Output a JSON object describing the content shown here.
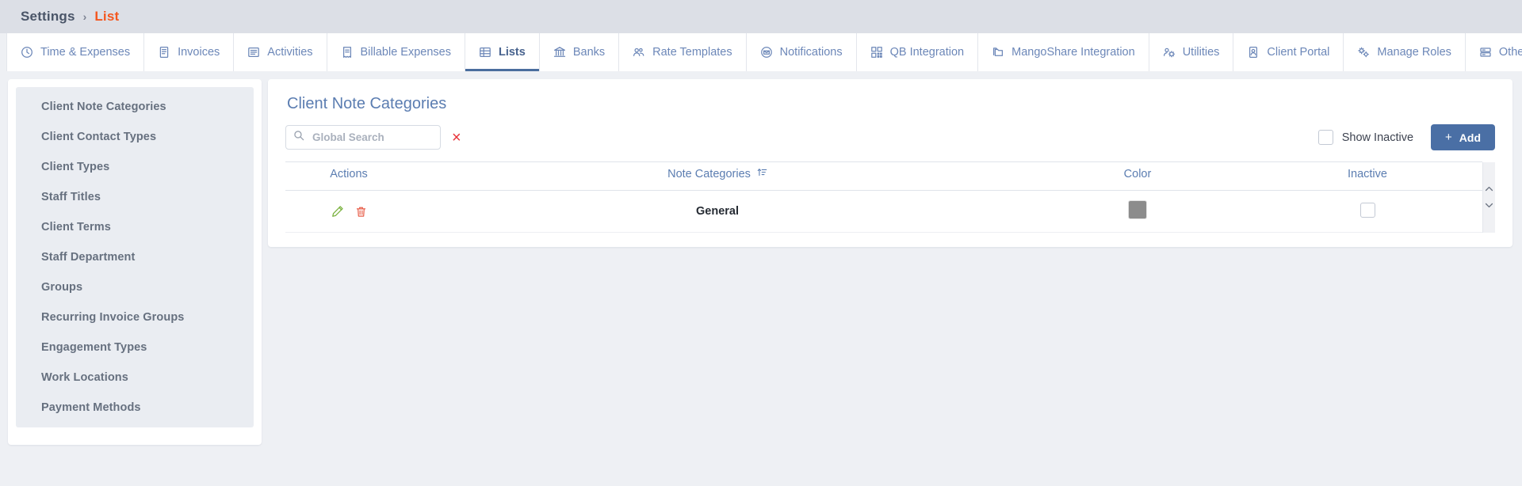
{
  "breadcrumb": {
    "root": "Settings",
    "separator": "›",
    "current": "List"
  },
  "tabs": [
    {
      "label": "Time & Expenses",
      "icon": "clock-icon",
      "active": false
    },
    {
      "label": "Invoices",
      "icon": "invoice-icon",
      "active": false
    },
    {
      "label": "Activities",
      "icon": "list-icon",
      "active": false
    },
    {
      "label": "Billable Expenses",
      "icon": "receipt-icon",
      "active": false
    },
    {
      "label": "Lists",
      "icon": "table-icon",
      "active": true
    },
    {
      "label": "Banks",
      "icon": "bank-icon",
      "active": false
    },
    {
      "label": "Rate Templates",
      "icon": "people-icon",
      "active": false
    },
    {
      "label": "Notifications",
      "icon": "envelope-icon",
      "active": false
    },
    {
      "label": "QB Integration",
      "icon": "grid-icon",
      "active": false
    },
    {
      "label": "MangoShare Integration",
      "icon": "folders-icon",
      "active": false
    },
    {
      "label": "Utilities",
      "icon": "gears-people-icon",
      "active": false
    },
    {
      "label": "Client Portal",
      "icon": "portal-icon",
      "active": false
    },
    {
      "label": "Manage Roles",
      "icon": "roles-gear-icon",
      "active": false
    },
    {
      "label": "Other",
      "icon": "server-icon",
      "active": false
    }
  ],
  "sidebar": {
    "items": [
      {
        "label": "Client Note Categories"
      },
      {
        "label": "Client Contact Types"
      },
      {
        "label": "Client Types"
      },
      {
        "label": "Staff Titles"
      },
      {
        "label": "Client Terms"
      },
      {
        "label": "Staff Department"
      },
      {
        "label": "Groups"
      },
      {
        "label": "Recurring Invoice Groups"
      },
      {
        "label": "Engagement Types"
      },
      {
        "label": "Work Locations"
      },
      {
        "label": "Payment Methods"
      }
    ]
  },
  "panel": {
    "title": "Client Note Categories",
    "search": {
      "value": "",
      "placeholder": "Global Search",
      "clear_label": "×"
    },
    "show_inactive_label": "Show Inactive",
    "show_inactive_checked": false,
    "add_button": {
      "plus": "+",
      "label": "Add"
    }
  },
  "table": {
    "columns": [
      {
        "key": "actions",
        "label": "Actions"
      },
      {
        "key": "name",
        "label": "Note Categories",
        "sortable": true
      },
      {
        "key": "color",
        "label": "Color"
      },
      {
        "key": "inactive",
        "label": "Inactive"
      }
    ],
    "rows": [
      {
        "name": "General",
        "color": "#8c8c8c",
        "inactive": false,
        "edit_icon": "pencil-icon",
        "delete_icon": "trash-icon"
      }
    ],
    "scroll_up": "⌃",
    "scroll_down": "⌄"
  },
  "colors": {
    "accent_blue": "#4a6fa5",
    "breadcrumb_current": "#f4571f",
    "tab_text": "#6c87b8",
    "clear_x": "#e8343a",
    "edit_icon": "#7cb342",
    "delete_icon": "#e8604c",
    "swatch_general": "#8c8c8c"
  }
}
